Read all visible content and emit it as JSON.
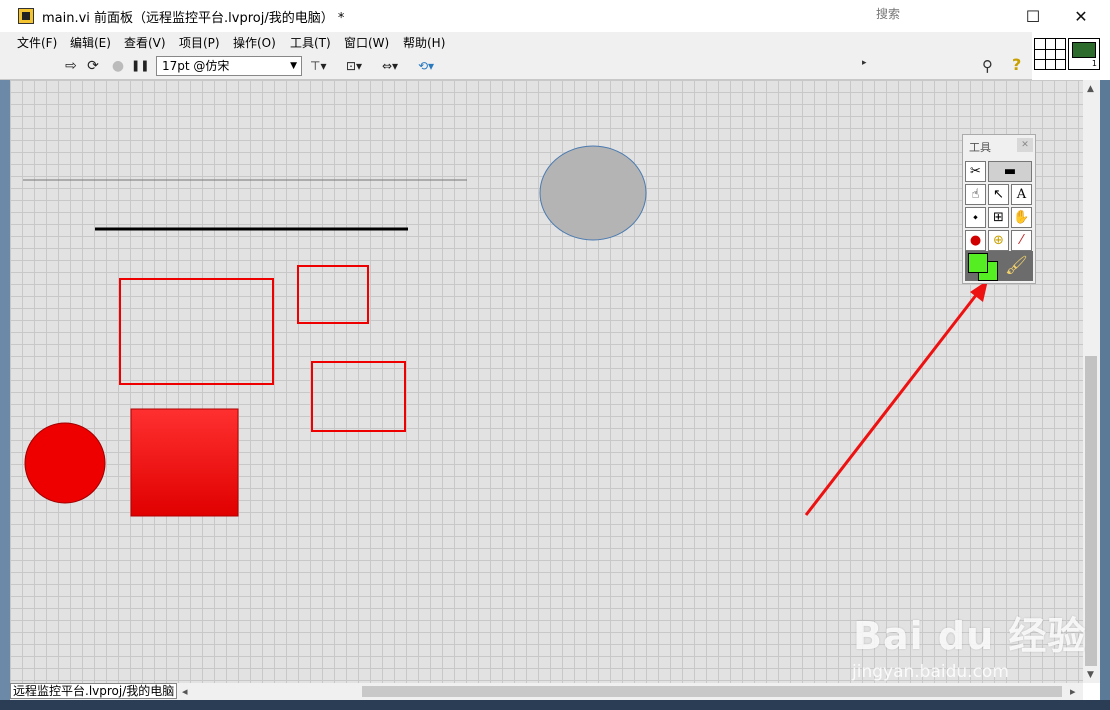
{
  "window": {
    "title": "main.vi 前面板（远程监控平台.lvproj/我的电脑） *",
    "minimize_glyph": "—",
    "maximize_glyph": "☐",
    "close_glyph": "✕"
  },
  "menu": {
    "items": [
      "文件(F)",
      "编辑(E)",
      "查看(V)",
      "项目(P)",
      "操作(O)",
      "工具(T)",
      "窗口(W)",
      "帮助(H)"
    ]
  },
  "toolbar": {
    "run_glyph": "⇨",
    "run_continuous_glyph": "⟳",
    "abort_glyph": "●",
    "pause_glyph": "❚❚",
    "font_value": "17pt @仿宋",
    "dropdown_arrow": "▼",
    "align_glyph": "⊤▾",
    "distribute_glyph": "⊡▾",
    "resize_glyph": "⇔▾",
    "reorder_glyph": "⟲▾",
    "search_placeholder": "搜索",
    "search_icon": "⚲",
    "help_icon": "?"
  },
  "tools_palette": {
    "title": "工具",
    "close_glyph": "✕",
    "cells": [
      "✂",
      "▬",
      "☝",
      "↖",
      "A",
      "⬩",
      "⊞",
      "✋",
      "●",
      "⊕",
      "⁄"
    ],
    "brush_glyph": "🖌",
    "fg_color": "#55ee22",
    "bg_color": "#55ee22"
  },
  "canvas_colors": {
    "accent_red": "#ee0000",
    "ellipse_gray": "#b4b4b4"
  },
  "status": {
    "path_text": "远程监控平台.lvproj/我的电脑"
  },
  "watermark": {
    "logo_text": "Bai du 经验",
    "url_text": "jingyan.baidu.com"
  }
}
